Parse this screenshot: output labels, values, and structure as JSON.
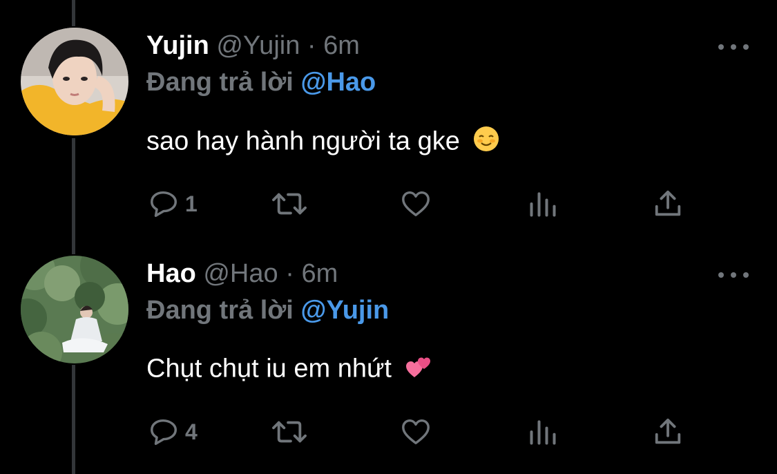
{
  "tweets": [
    {
      "display_name": "Yujin",
      "handle": "@Yujin",
      "separator": "·",
      "time": "6m",
      "replying_prefix": "Đang trả lời",
      "replying_to": "@Hao",
      "text": "sao hay hành người ta gke",
      "emoji": "smiling-face-emoji",
      "reply_count": "1",
      "avatar": "avatar-yujin-yellow-shirt"
    },
    {
      "display_name": "Hao",
      "handle": "@Hao",
      "separator": "·",
      "time": "6m",
      "replying_prefix": "Đang trả lời",
      "replying_to": "@Yujin",
      "text": "Chụt chụt iu em nhứt",
      "emoji": "two-hearts-emoji",
      "reply_count": "4",
      "avatar": "avatar-hao-outdoor-greenery"
    }
  ],
  "icons": {
    "reply": "reply-icon",
    "retweet": "retweet-icon",
    "like": "heart-icon",
    "analytics": "analytics-icon",
    "share": "share-icon",
    "more": "more-icon"
  },
  "colors": {
    "background": "#000000",
    "name": "#ffffff",
    "secondary": "#71767b",
    "mention": "#4a99e9",
    "thread_line": "#333639"
  }
}
